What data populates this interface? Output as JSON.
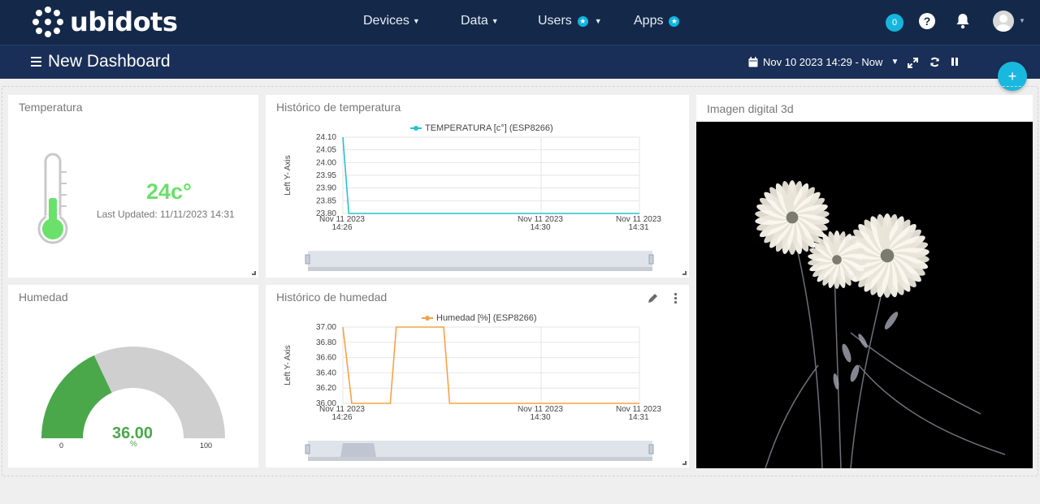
{
  "nav": {
    "logo_text": "ubidots",
    "menu": [
      {
        "label": "Devices"
      },
      {
        "label": "Data"
      },
      {
        "label": "Users"
      },
      {
        "label": "Apps"
      }
    ],
    "notif_count": "0",
    "help_label": "?"
  },
  "subbar": {
    "title": "New Dashboard",
    "date_range": "Nov 10 2023 14:29 - Now"
  },
  "fab_label": "+",
  "widgets": {
    "temperature": {
      "title": "Temperatura",
      "value": "24c°",
      "updated": "Last Updated: 11/11/2023 14:31"
    },
    "temp_history": {
      "title": "Histórico de temperatura",
      "legend": "TEMPERATURA [c°] (ESP8266)",
      "y_axis_label": "Left Y- Axis",
      "color": "#28c2cc"
    },
    "humidity": {
      "title": "Humedad",
      "value": "36.00",
      "unit": "%",
      "min": "0",
      "max": "100",
      "percent": 0.36,
      "fill_color": "#4aa84a",
      "rest_color": "#cfcfcf"
    },
    "hum_history": {
      "title": "Histórico de humedad",
      "legend": "Humedad [%] (ESP8266)",
      "y_axis_label": "Left Y- Axis",
      "color": "#f4a347"
    },
    "image": {
      "title": "Imagen digital 3d"
    }
  },
  "chart_data": [
    {
      "type": "line",
      "title": "",
      "series": [
        {
          "name": "TEMPERATURA [c°] (ESP8266)",
          "points": [
            [
              0,
              24.1
            ],
            [
              0.1,
              23.8
            ],
            [
              5,
              23.8
            ]
          ]
        }
      ],
      "ylabel": "Left Y- Axis",
      "y_ticks": [
        "24.10",
        "24.05",
        "24.00",
        "23.95",
        "23.90",
        "23.85",
        "23.80"
      ],
      "x_ticks": [
        [
          "Nov 11 2023",
          "14:26"
        ],
        [
          "Nov 11 2023",
          "14:30"
        ],
        [
          "Nov 11 2023",
          "14:31"
        ]
      ],
      "ylim": [
        23.8,
        24.1
      ]
    },
    {
      "type": "line",
      "title": "",
      "series": [
        {
          "name": "Humedad [%] (ESP8266)",
          "points": [
            [
              0,
              37.0
            ],
            [
              0.15,
              36.0
            ],
            [
              0.8,
              36.0
            ],
            [
              0.9,
              37.0
            ],
            [
              1.7,
              37.0
            ],
            [
              1.8,
              36.0
            ],
            [
              5,
              36.0
            ]
          ]
        }
      ],
      "ylabel": "Left Y- Axis",
      "y_ticks": [
        "37.00",
        "36.80",
        "36.60",
        "36.40",
        "36.20",
        "36.00"
      ],
      "x_ticks": [
        [
          "Nov 11 2023",
          "14:26"
        ],
        [
          "Nov 11 2023",
          "14:30"
        ],
        [
          "Nov 11 2023",
          "14:31"
        ]
      ],
      "ylim": [
        36.0,
        37.0
      ]
    }
  ]
}
